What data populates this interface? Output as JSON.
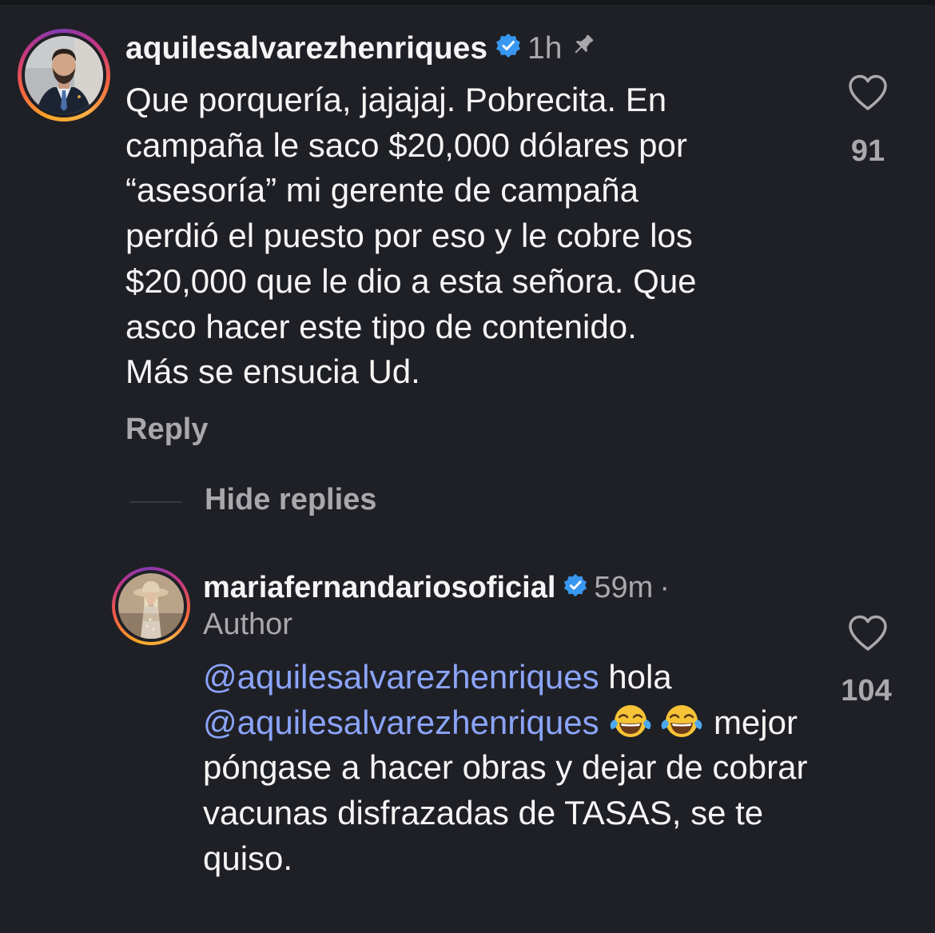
{
  "comment": {
    "username": "aquilesalvarezhenriques",
    "time": "1h",
    "verified": true,
    "pinned": true,
    "text": "Que porquería, jajajaj. Pobrecita. En\ncampaña le saco $20,000 dólares por\n“asesoría” mi gerente de campaña\nperdió el puesto por eso y le cobre los\n$20,000 que le dio a esta señora. Que\nasco hacer este tipo de contenido.\nMás se ensucia Ud.",
    "like_count": "91",
    "reply_label": "Reply"
  },
  "thread": {
    "hide_replies_label": "Hide replies"
  },
  "reply": {
    "username": "mariafernandariosoficial",
    "time": "59m",
    "separator": "·",
    "author_label": "Author",
    "verified": true,
    "mention_1": "@aquilesalvarezhenriques",
    "word_1": " hola",
    "mention_2": "@aquilesalvarezhenriques",
    "emoji": "face-with-tears-of-joy",
    "text_rest": "mejor póngase a hacer obras y dejar de cobrar vacunas disfrazadas de TASAS, se te quiso.",
    "like_count": "104"
  },
  "colors": {
    "background": "#1f2026",
    "text": "#f5f5f5",
    "secondary_text": "#a8a8ad",
    "mention": "#8ba4f9",
    "verified_badge": "#3897f0"
  }
}
